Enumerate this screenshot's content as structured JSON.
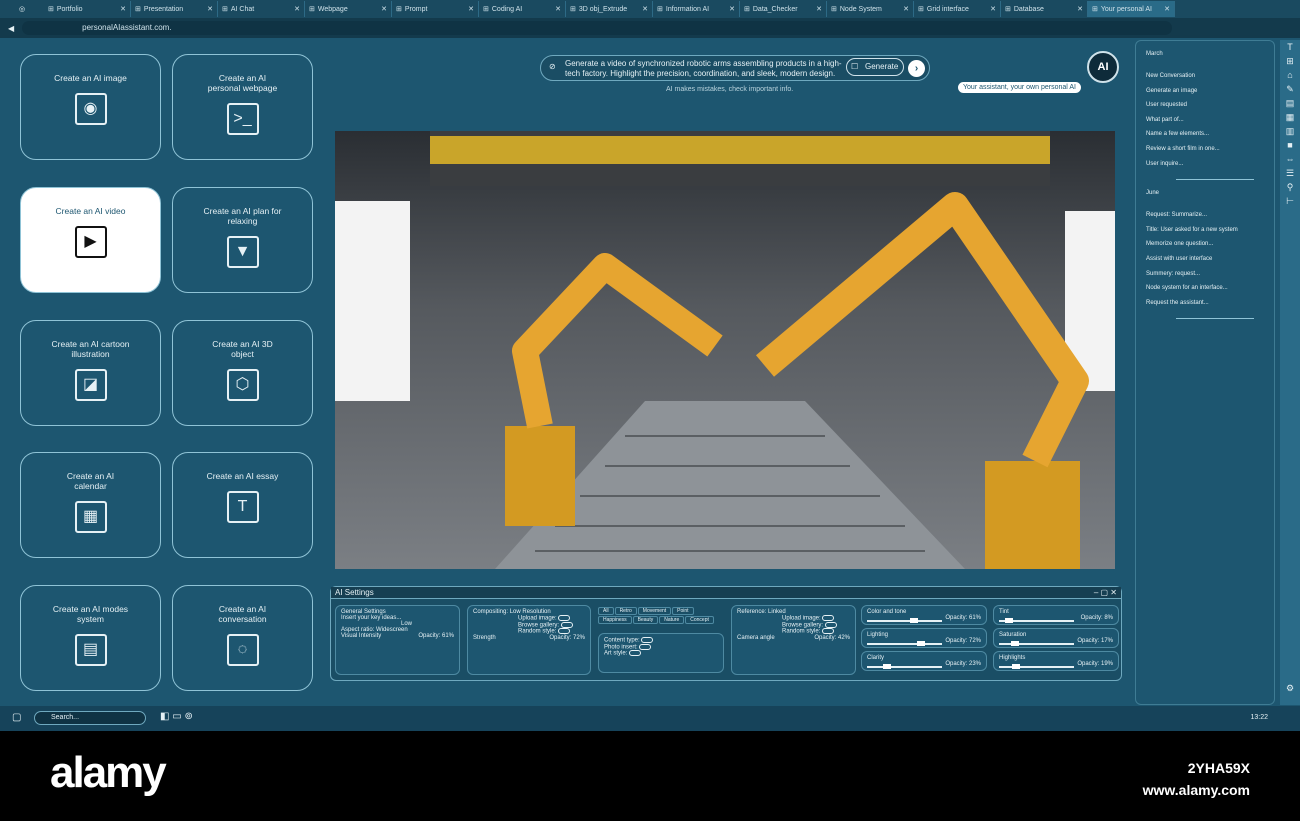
{
  "browser": {
    "tabs": [
      "Portfolio",
      "Presentation",
      "AI Chat",
      "Webpage",
      "Prompt",
      "Coding AI",
      "3D obj_Extrude",
      "Information AI",
      "Data_Checker",
      "Node System",
      "Grid interface",
      "Database",
      "Your personal AI"
    ],
    "url": "personalAIassistant.com."
  },
  "cards": [
    {
      "label": "Create an AI image",
      "icon": "image-icon"
    },
    {
      "label": "Create an AI personal webpage",
      "icon": "terminal-icon"
    },
    {
      "label": "Create an AI video",
      "icon": "play-icon"
    },
    {
      "label": "Create an AI plan for relaxing",
      "icon": "cup-icon"
    },
    {
      "label": "Create an AI cartoon illustration",
      "icon": "illustration-icon"
    },
    {
      "label": "Create an AI 3D object",
      "icon": "cube-icon"
    },
    {
      "label": "Create an AI calendar",
      "icon": "calendar-icon"
    },
    {
      "label": "Create an AI essay",
      "icon": "text-icon"
    },
    {
      "label": "Create an AI modes system",
      "icon": "grid-icon"
    },
    {
      "label": "Create an AI conversation",
      "icon": "loading-icon"
    }
  ],
  "prompt": {
    "text": "Generate a video of synchronized robotic arms assembling products in a high-tech factory. Highlight the precision, coordination, and sleek, modern design.",
    "generate_label": "Generate",
    "disclaimer": "AI makes mistakes, check important info.",
    "tooltip": "Your assistant, your own personal AI",
    "avatar": "AI"
  },
  "settings": {
    "title": "AI Settings",
    "general": {
      "item1": "General Settings",
      "item2": "Insert your key ideas...",
      "quality_value": "Low",
      "aspect_label": "Aspect ratio:",
      "aspect_value": "Widescreen",
      "intensity_label": "Visual Intensity",
      "intensity_opacity": "Opacity: 61%"
    },
    "compositing": {
      "label": "Compositing:",
      "value": "Low Resolution",
      "upload": "Upload image:",
      "browse": "Browse gallery:",
      "random": "Random style:",
      "strength_label": "Strength",
      "strength_opacity": "Opacity: 72%"
    },
    "chips": [
      "All",
      "Retro",
      "Movement",
      "Point",
      "Happiness",
      "Beauty",
      "Nature",
      "Concept"
    ],
    "content": {
      "type": "Content type:",
      "photo": "Photo insert:",
      "art": "Art style:"
    },
    "reference": {
      "label": "Reference:",
      "value": "Linked",
      "upload": "Upload image:",
      "browse": "Browse gallery:",
      "random": "Random style:",
      "camera_label": "Camera angle",
      "camera_opacity": "Opacity: 42%"
    },
    "sliders": [
      {
        "label": "Color and tone",
        "opacity": "Opacity: 61%",
        "value": 61
      },
      {
        "label": "Tint",
        "opacity": "Opacity: 8%",
        "value": 8
      },
      {
        "label": "Lighting",
        "opacity": "Opacity: 72%",
        "value": 72
      },
      {
        "label": "Saturation",
        "opacity": "Opacity: 17%",
        "value": 17
      },
      {
        "label": "Clarity",
        "opacity": "Opacity: 23%",
        "value": 23
      },
      {
        "label": "Highlights",
        "opacity": "Opacity: 19%",
        "value": 19
      }
    ]
  },
  "history": {
    "groups": [
      {
        "title": "March",
        "items": [
          "New Conversation",
          "Generate an image",
          "User requested",
          "What part of...",
          "Name a few elements...",
          "Review a short film in one...",
          "User inquire..."
        ]
      },
      {
        "title": "June",
        "items": [
          "Request: Summarize...",
          "Title: User asked for a new system",
          "Memorize one question...",
          "Assist with user interface",
          "Summery: request...",
          "Node system for an interface...",
          "Request the assistant..."
        ]
      }
    ]
  },
  "taskbar": {
    "search_placeholder": "Search...",
    "time": "13:22"
  },
  "watermark": {
    "logo": "alamy",
    "id": "2YHA59X",
    "site": "www.alamy.com"
  }
}
